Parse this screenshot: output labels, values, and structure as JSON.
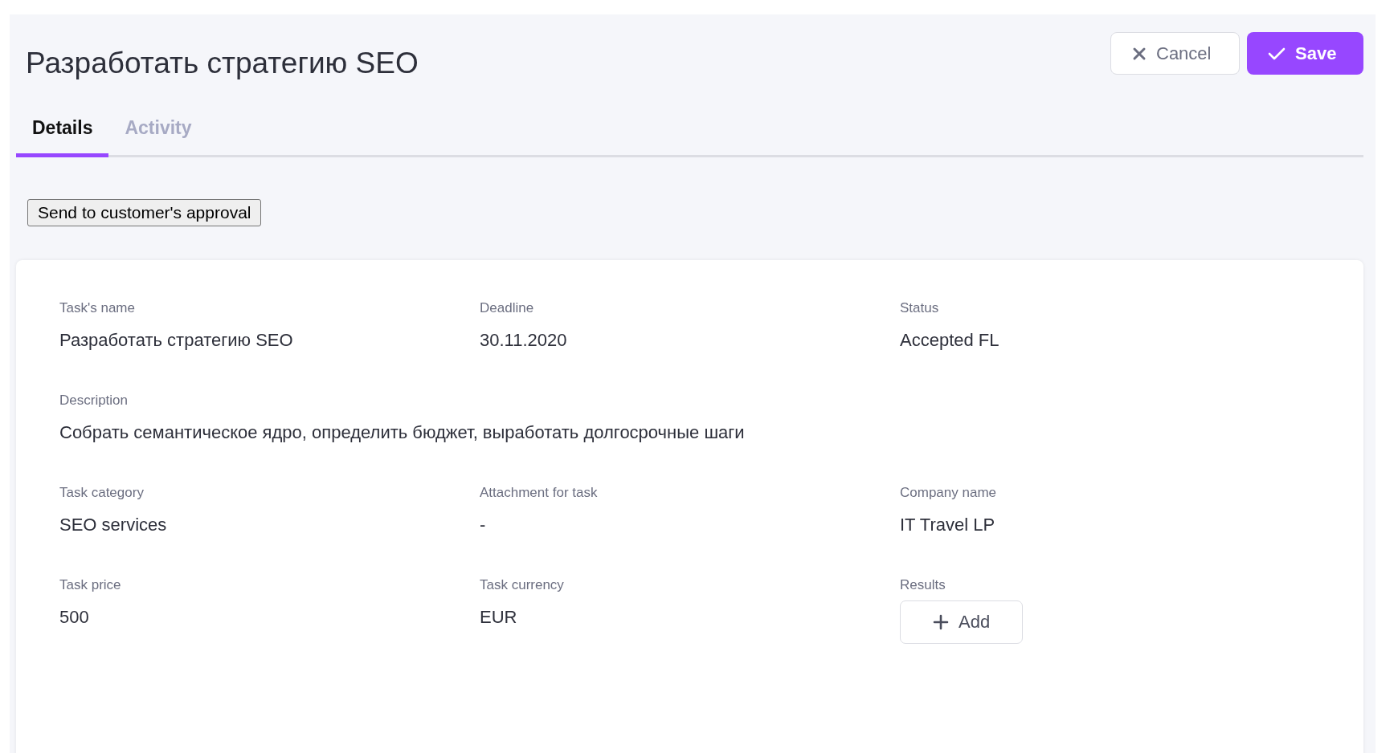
{
  "page": {
    "title": "Разработать стратегию SEO"
  },
  "header_buttons": [
    {
      "kind": "cancel",
      "label": "Cancel"
    },
    {
      "kind": "save",
      "label": "Save"
    }
  ],
  "tabs": [
    {
      "label": "Details",
      "selected": true
    },
    {
      "label": "Activity",
      "selected": false
    }
  ],
  "action_button": {
    "label": "Send to customer's approval"
  },
  "details": {
    "rows": [
      [
        {
          "label": "Task's name",
          "kind": "text",
          "value": "Разработать стратегию SEO"
        },
        {
          "label": "Deadline",
          "kind": "text",
          "value": "30.11.2020"
        },
        {
          "label": "Status",
          "kind": "text",
          "value": "Accepted FL"
        }
      ],
      [
        {
          "label": "Description",
          "kind": "wide",
          "value": "Собрать семантическое ядро, определить бюджет, выработать долгосрочные шаги"
        }
      ],
      [
        {
          "label": "Task category",
          "kind": "text",
          "value": "SEO services"
        },
        {
          "label": "Attachment for task",
          "kind": "text",
          "value": "-"
        },
        {
          "label": "Company name",
          "kind": "text",
          "value": "IT Travel LP"
        }
      ],
      [
        {
          "label": "Task price",
          "kind": "text",
          "value": "500"
        },
        {
          "label": "Task currency",
          "kind": "text",
          "value": "EUR"
        },
        {
          "label": "Results",
          "kind": "add_button",
          "value": "Add"
        }
      ]
    ]
  }
}
